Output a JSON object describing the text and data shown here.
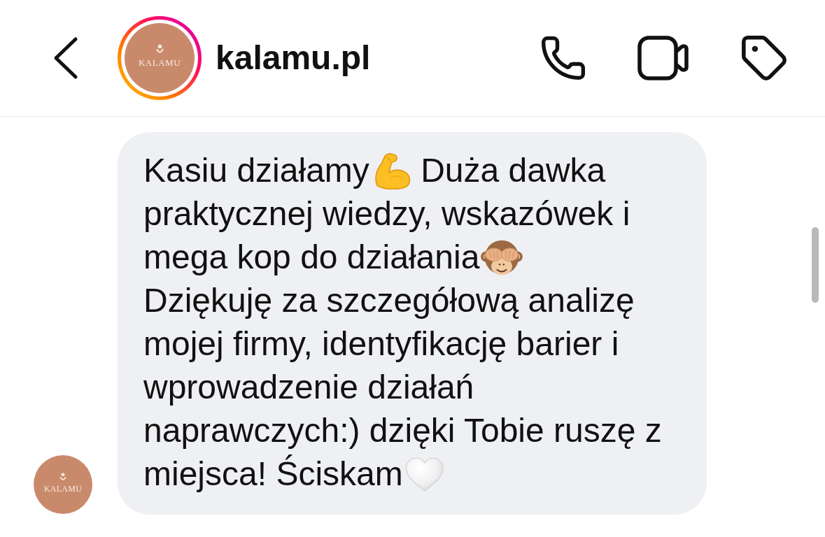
{
  "header": {
    "avatar": {
      "logo_text": "KALAMU",
      "story": true
    },
    "username": "kalamu.pl"
  },
  "message": {
    "avatar": {
      "logo_text": "KALAMU"
    },
    "lines": [
      {
        "parts": [
          {
            "kind": "text",
            "text": "Kasiu działamy"
          },
          {
            "kind": "biceps"
          },
          {
            "kind": "text",
            "text": " Duża dawka"
          }
        ]
      },
      {
        "parts": [
          {
            "kind": "text",
            "text": "praktycznej wiedzy, wskazówek i"
          }
        ]
      },
      {
        "parts": [
          {
            "kind": "text",
            "text": "mega kop do działania"
          },
          {
            "kind": "monkey"
          }
        ]
      },
      {
        "parts": [
          {
            "kind": "text",
            "text": "Dziękuję za szczegółową analizę"
          }
        ]
      },
      {
        "parts": [
          {
            "kind": "text",
            "text": "mojej firmy, identyfikację barier i"
          }
        ]
      },
      {
        "parts": [
          {
            "kind": "text",
            "text": "wprowadzenie działań"
          }
        ]
      },
      {
        "parts": [
          {
            "kind": "text",
            "text": "naprawczych:) dzięki Tobie ruszę z"
          }
        ]
      },
      {
        "parts": [
          {
            "kind": "text",
            "text": "miejsca! Ściskam"
          },
          {
            "kind": "heart"
          }
        ]
      }
    ]
  }
}
